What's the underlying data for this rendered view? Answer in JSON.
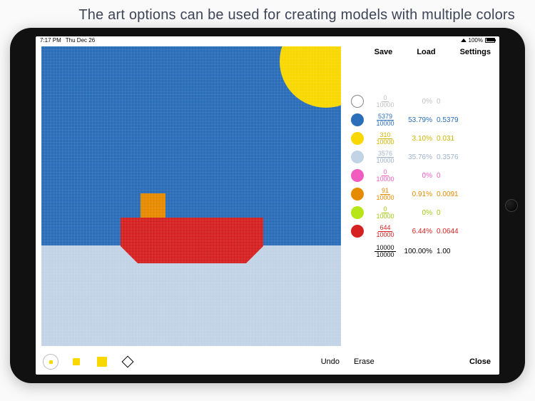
{
  "caption": "The art options can be used for creating models with multiple colors",
  "status": {
    "time": "7:17 PM",
    "date": "Thu Dec 26",
    "battery": "100%"
  },
  "actions": {
    "save": "Save",
    "load": "Load",
    "settings": "Settings",
    "undo": "Undo",
    "erase": "Erase",
    "close": "Close"
  },
  "canvas": {
    "sky_color": "#2a6db8",
    "sea_color": "#c2d3e6",
    "sun_color": "#f9d700",
    "hull_color": "#d52121",
    "cabin_color": "#e68a00"
  },
  "palette": {
    "denominator": "10000",
    "rows": [
      {
        "name": "white",
        "hex": "#ffffff",
        "outlined": true,
        "count": "0",
        "pct": "0%",
        "dec": "0",
        "textColor": "#bfbfbf"
      },
      {
        "name": "blue",
        "hex": "#2a6db8",
        "outlined": false,
        "count": "5379",
        "pct": "53.79%",
        "dec": "0.5379",
        "textColor": "#2a6db8"
      },
      {
        "name": "yellow",
        "hex": "#f9d700",
        "outlined": false,
        "count": "310",
        "pct": "3.10%",
        "dec": "0.031",
        "textColor": "#d0b400"
      },
      {
        "name": "ltblue",
        "hex": "#c2d3e6",
        "outlined": false,
        "count": "3576",
        "pct": "35.76%",
        "dec": "0.3576",
        "textColor": "#9fb3cb"
      },
      {
        "name": "pink",
        "hex": "#f25cc1",
        "outlined": false,
        "count": "0",
        "pct": "0%",
        "dec": "0",
        "textColor": "#f25cc1"
      },
      {
        "name": "orange",
        "hex": "#e68a00",
        "outlined": false,
        "count": "91",
        "pct": "0.91%",
        "dec": "0.0091",
        "textColor": "#e68a00"
      },
      {
        "name": "lime",
        "hex": "#b6e617",
        "outlined": false,
        "count": "0",
        "pct": "0%",
        "dec": "0",
        "textColor": "#9fc90f"
      },
      {
        "name": "red",
        "hex": "#d52121",
        "outlined": false,
        "count": "644",
        "pct": "6.44%",
        "dec": "0.0644",
        "textColor": "#d52121"
      }
    ],
    "total": {
      "num": "10000",
      "den": "10000",
      "pct": "100.00%",
      "dec": "1.00"
    }
  }
}
